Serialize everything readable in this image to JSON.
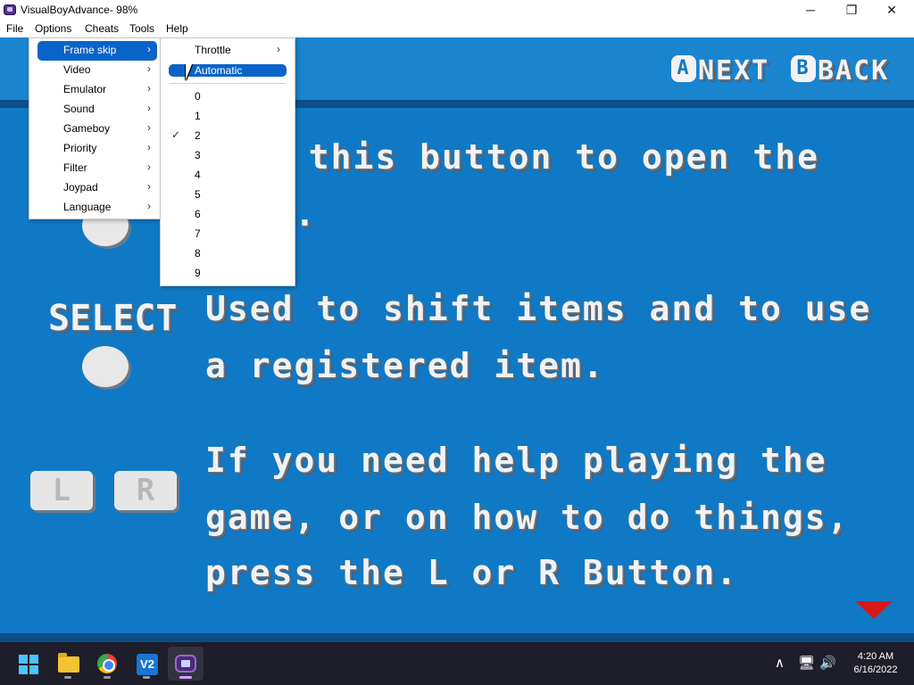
{
  "window": {
    "title": "VisualBoyAdvance- 98%",
    "controls": {
      "minimize": "─",
      "maximize": "❐",
      "close": "✕"
    }
  },
  "menubar": [
    "File",
    "Options",
    "Cheats",
    "Tools",
    "Help"
  ],
  "options_menu": {
    "items": [
      {
        "label": "Frame skip",
        "has_submenu": true,
        "active": true
      },
      {
        "label": "Video",
        "has_submenu": true
      },
      {
        "label": "Emulator",
        "has_submenu": true
      },
      {
        "label": "Sound",
        "has_submenu": true
      },
      {
        "label": "Gameboy",
        "has_submenu": true
      },
      {
        "label": "Priority",
        "has_submenu": true
      },
      {
        "label": "Filter",
        "has_submenu": true
      },
      {
        "label": "Joypad",
        "has_submenu": true
      },
      {
        "label": "Language",
        "has_submenu": true
      }
    ],
    "submenu_arrow": "›"
  },
  "frameskip_menu": {
    "throttle": "Throttle",
    "automatic": "Automatic",
    "values": [
      "0",
      "1",
      "2",
      "3",
      "4",
      "5",
      "6",
      "7",
      "8",
      "9"
    ],
    "checked_value": "2",
    "check_glyph": "✓"
  },
  "game": {
    "nav": {
      "a_badge": "A",
      "a_label": "NEXT",
      "b_badge": "B",
      "b_label": "BACK"
    },
    "line1": "s this button to open the",
    "line2": ".",
    "select_label": "SELECT",
    "line3": "Used to shift items and to use",
    "line4": "a registered item.",
    "line5": "If you need help playing the",
    "line6": "game, or on how to do things,",
    "line7": "press the L or R Button.",
    "l_button": "L",
    "r_button": "R",
    "colors": {
      "background": "#1079c5",
      "stripe": "#0a4f88",
      "arrow": "#d81818"
    }
  },
  "taskbar": {
    "apps": [
      "start-icon",
      "file-explorer-icon",
      "chrome-icon",
      "vscode-icon",
      "visualboyadvance-icon"
    ],
    "vscode_glyph": "V2",
    "tray": {
      "chevron": "∧",
      "network": "🖥",
      "volume": "🔊"
    },
    "time": "4:20 AM",
    "date": "6/16/2022"
  }
}
